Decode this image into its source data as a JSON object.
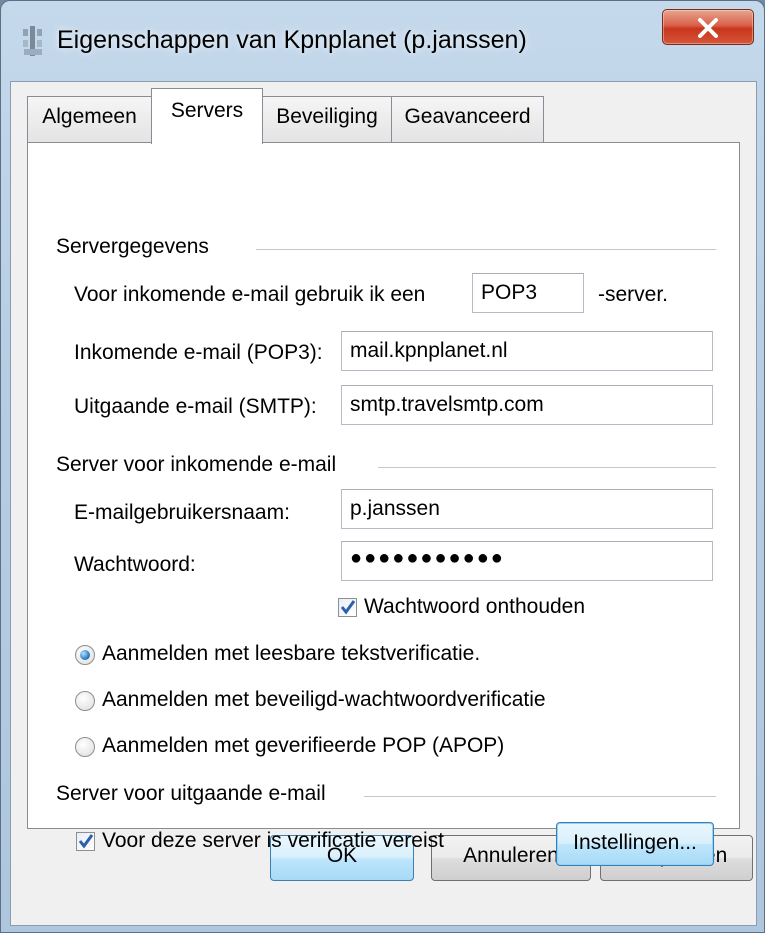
{
  "window": {
    "title": "Eigenschappen van Kpnplanet (p.janssen)",
    "close_symbol": "X"
  },
  "tabs": [
    {
      "label": "Algemeen",
      "active": false
    },
    {
      "label": "Servers",
      "active": true
    },
    {
      "label": "Beveiliging",
      "active": false
    },
    {
      "label": "Geavanceerd",
      "active": false
    }
  ],
  "server_info": {
    "heading": "Servergegevens",
    "incoming_type_prefix": "Voor inkomende e-mail gebruik ik een",
    "incoming_type_value": "POP3",
    "incoming_type_suffix": "-server.",
    "incoming_label": "Inkomende e-mail (POP3):",
    "incoming_value": "mail.kpnplanet.nl",
    "outgoing_label": "Uitgaande e-mail (SMTP):",
    "outgoing_value": "smtp.travelsmtp.com"
  },
  "incoming_server": {
    "heading": "Server voor inkomende e-mail",
    "username_label": "E-mailgebruikersnaam:",
    "username_value": "p.janssen",
    "password_label": "Wachtwoord:",
    "password_value": "●●●●●●●●●●●",
    "remember_label": "Wachtwoord onthouden",
    "remember_checked": true,
    "auth_options": [
      {
        "label": "Aanmelden met leesbare tekstverificatie.",
        "selected": true
      },
      {
        "label": "Aanmelden met beveiligd-wachtwoordverificatie",
        "selected": false
      },
      {
        "label": "Aanmelden met geverifieerde POP (APOP)",
        "selected": false
      }
    ]
  },
  "outgoing_server": {
    "heading": "Server voor uitgaande e-mail",
    "auth_required_label": "Voor deze server is verificatie vereist",
    "auth_required_checked": true,
    "settings_button": "Instellingen..."
  },
  "footer": {
    "ok": "OK",
    "cancel": "Annuleren",
    "apply": "Toepassen"
  },
  "colors": {
    "checkmark": "#2f5fa8",
    "radio_selected": "#1f6fb8",
    "close_button": "#c8361c"
  }
}
